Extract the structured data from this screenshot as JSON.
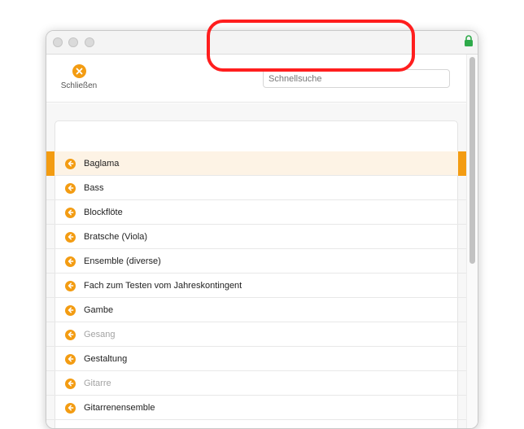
{
  "toolbar": {
    "close_label": "Schließen",
    "search_placeholder": "Schnellsuche",
    "search_value": ""
  },
  "colors": {
    "accent": "#f39c12",
    "highlight": "#ff1e1e"
  },
  "list": {
    "items": [
      {
        "label": "Baglama",
        "state": "selected"
      },
      {
        "label": "Bass",
        "state": "normal"
      },
      {
        "label": "Blockflöte",
        "state": "normal"
      },
      {
        "label": "Bratsche (Viola)",
        "state": "normal"
      },
      {
        "label": "Ensemble (diverse)",
        "state": "normal"
      },
      {
        "label": "Fach zum Testen vom Jahreskontingent",
        "state": "normal"
      },
      {
        "label": "Gambe",
        "state": "normal"
      },
      {
        "label": "Gesang",
        "state": "disabled"
      },
      {
        "label": "Gestaltung",
        "state": "normal"
      },
      {
        "label": "Gitarre",
        "state": "disabled"
      },
      {
        "label": "Gitarrenensemble",
        "state": "normal"
      }
    ]
  }
}
